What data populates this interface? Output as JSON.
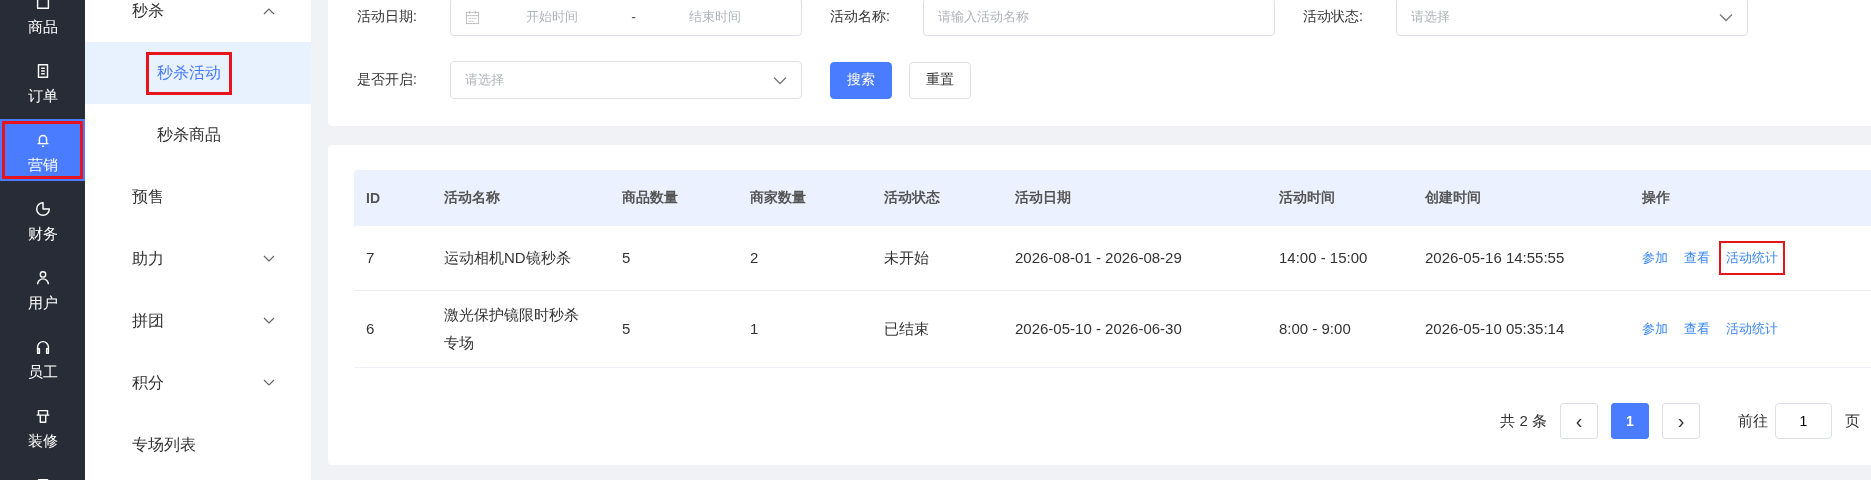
{
  "nav": [
    {
      "label": "商品",
      "selected": false,
      "annotated": false
    },
    {
      "label": "订单",
      "selected": false,
      "annotated": false
    },
    {
      "label": "营销",
      "selected": true,
      "annotated": true
    },
    {
      "label": "财务",
      "selected": false,
      "annotated": false
    },
    {
      "label": "用户",
      "selected": false,
      "annotated": false
    },
    {
      "label": "员工",
      "selected": false,
      "annotated": false
    },
    {
      "label": "装修",
      "selected": false,
      "annotated": false
    },
    {
      "selected": false,
      "annotated": false
    }
  ],
  "submenu": [
    {
      "label": "秒杀",
      "expanded": true,
      "children": [
        {
          "label": "秒杀活动",
          "selected": true,
          "annotated": true
        },
        {
          "label": "秒杀商品",
          "selected": false,
          "annotated": false
        }
      ]
    },
    {
      "label": "预售"
    },
    {
      "label": "助力",
      "expanded": false
    },
    {
      "label": "拼团",
      "expanded": false
    },
    {
      "label": "积分",
      "expanded": false
    },
    {
      "label": "专场列表"
    }
  ],
  "filters": [
    {
      "kind": "daterange",
      "label": "活动日期:",
      "start_placeholder": "开始时间",
      "separator": "-",
      "end_placeholder": "结束时间"
    },
    {
      "kind": "input",
      "label": "活动名称:",
      "placeholder": "请输入活动名称"
    },
    {
      "kind": "select",
      "label": "活动状态:",
      "placeholder": "请选择"
    },
    {
      "kind": "select",
      "label": "是否开启:",
      "placeholder": "请选择"
    }
  ],
  "buttons": [
    {
      "label": "搜索",
      "kind": "primary"
    },
    {
      "label": "重置",
      "kind": "default"
    }
  ],
  "table": {
    "columns": [
      "ID",
      "活动名称",
      "商品数量",
      "商家数量",
      "活动状态",
      "活动日期",
      "活动时间",
      "创建时间",
      "操作"
    ],
    "rows": [
      {
        "cells": [
          "7",
          "运动相机ND镜秒杀",
          "5",
          "2",
          "未开始",
          "2026-08-01 - 2026-08-29",
          "14:00 - 15:00",
          "2026-05-16 14:55:55"
        ],
        "actions": [
          {
            "label": "参加",
            "annotated": false
          },
          {
            "label": "查看",
            "annotated": false
          },
          {
            "label": "活动统计",
            "annotated": true
          }
        ]
      },
      {
        "cells": [
          "6",
          "激光保护镜限时秒杀专场",
          "5",
          "1",
          "已结束",
          "2026-05-10 - 2026-06-30",
          "8:00 - 9:00",
          "2026-05-10 05:35:14"
        ],
        "actions": [
          {
            "label": "参加",
            "annotated": false
          },
          {
            "label": "查看",
            "annotated": false
          },
          {
            "label": "活动统计",
            "annotated": false
          }
        ]
      }
    ]
  },
  "pagination": {
    "total": "共 2 条",
    "prev": "‹",
    "pages": [
      {
        "label": "1",
        "selected": true
      }
    ],
    "next": "›",
    "goto_label": "前往",
    "goto_value": "1",
    "goto_suffix": "页"
  }
}
